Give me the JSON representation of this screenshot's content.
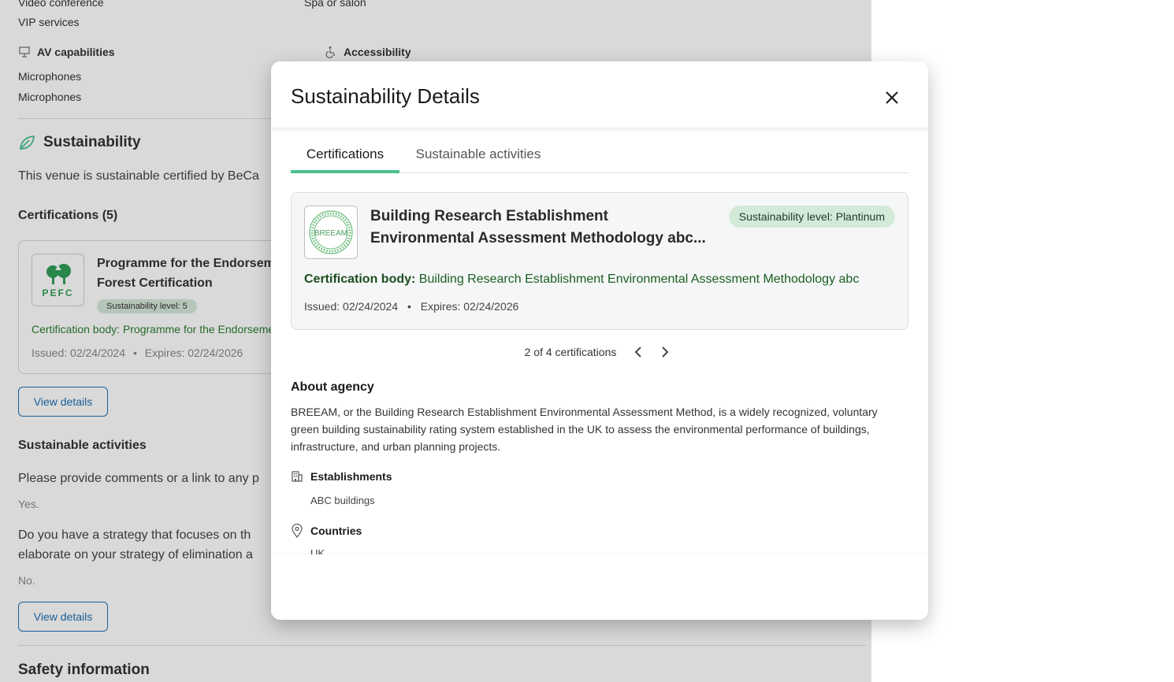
{
  "background": {
    "services_left": [
      "Video conference",
      "VIP services"
    ],
    "services_right": [
      "Spa or salon"
    ],
    "av_heading": "AV capabilities",
    "av_items": [
      "Microphones",
      "Microphones"
    ],
    "accessibility_heading": "Accessibility",
    "sustainability_title": "Sustainability",
    "sustainability_text": "This venue is sustainable certified by BeCa",
    "certifications_heading": "Certifications (5)",
    "card": {
      "logo_text": "PEFC",
      "title_line1": "Programme for the Endorsement of",
      "title_line2": "Forest Certification",
      "level": "Sustainability level: 5",
      "body": "Certification body: Programme for the Endorsement",
      "issued": "Issued: 02/24/2024",
      "expires": "Expires: 02/24/2026",
      "separator": "•"
    },
    "view_details_1": "View details",
    "activities_heading": "Sustainable activities",
    "question_1": "Please provide comments or a link to any p",
    "answer_1": "Yes.",
    "question_2_line1": "Do you have a strategy that focuses on th",
    "question_2_line2": "elaborate on your strategy of elimination a",
    "answer_2": "No.",
    "view_details_2": "View details",
    "safety_heading": "Safety information"
  },
  "modal": {
    "title": "Sustainability Details",
    "tabs": [
      "Certifications",
      "Sustainable activities"
    ],
    "active_tab": "Certifications",
    "certificate": {
      "logo_text": "BREEAM",
      "title_line1": "Building Research Establishment",
      "title_line2": "Environmental Assessment Methodology abc...",
      "level": "Sustainability level: Plantinum",
      "body_label": "Certification body:",
      "body_value": "Building Research Establishment Environmental Assessment Methodology abc",
      "issued": "Issued: 02/24/2024",
      "separator": "•",
      "expires": "Expires: 02/24/2026"
    },
    "pager": {
      "text": "2 of 4 certifications"
    },
    "about": {
      "heading": "About agency",
      "text": "BREEAM, or the Building Research Establishment Environmental Assessment Method, is a widely recognized, voluntary green building sustainability rating system established in the UK to assess the environmental performance of buildings, infrastructure, and urban planning projects."
    },
    "establishments": {
      "heading": "Establishments",
      "value": "ABC buildings"
    },
    "countries": {
      "heading": "Countries",
      "value": "UK"
    }
  },
  "colors": {
    "accent_green": "#4cbf8f",
    "badge_green": "#d4ead9",
    "link_blue": "#1f6fb2",
    "body_green": "#1b5e20"
  }
}
